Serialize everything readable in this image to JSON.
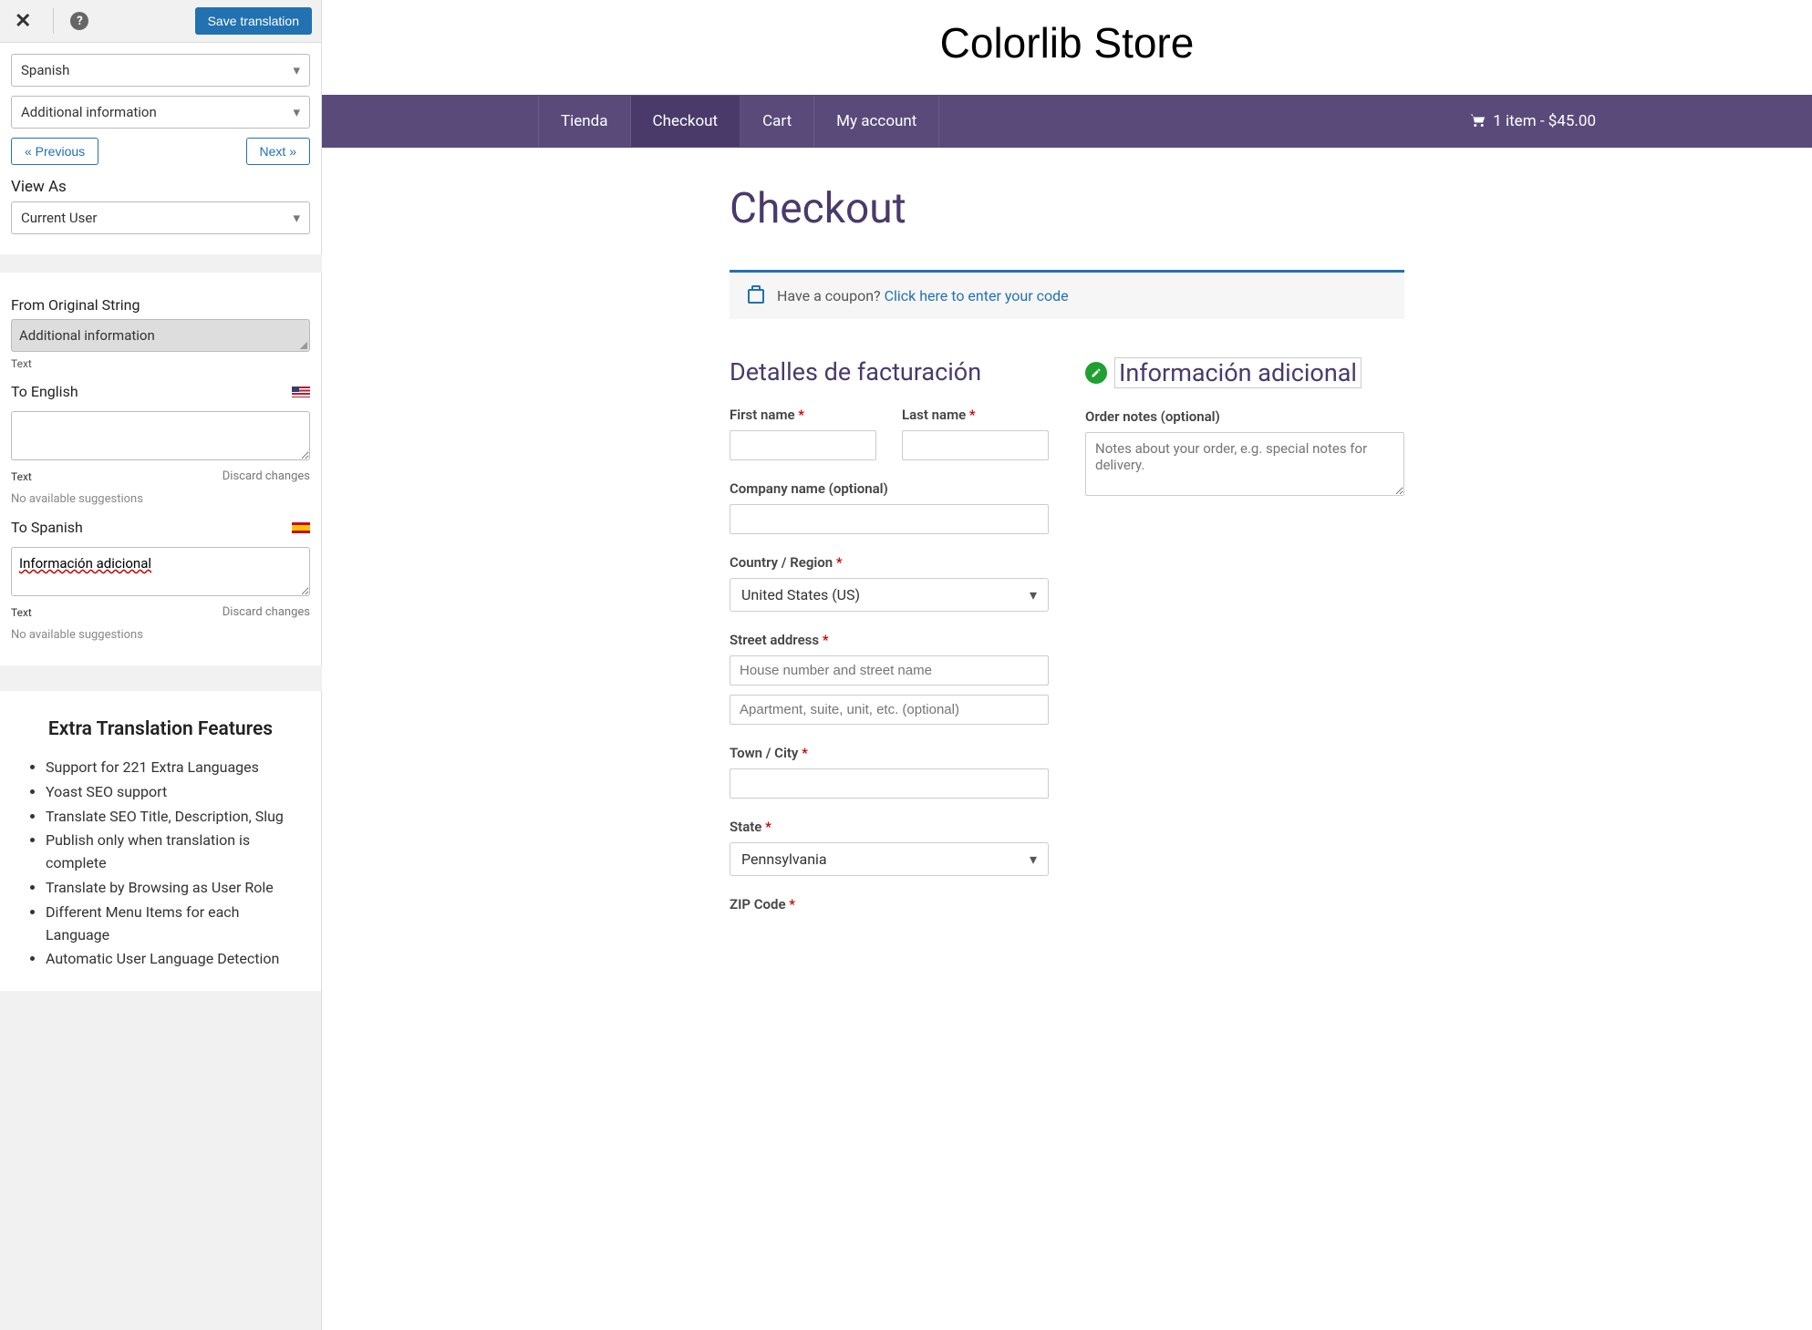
{
  "sidebar": {
    "save_label": "Save translation",
    "language_select": "Spanish",
    "string_select": "Additional information",
    "prev_label": "« Previous",
    "next_label": "Next »",
    "view_as_label": "View As",
    "view_as_value": "Current User",
    "from_label": "From Original String",
    "from_value": "Additional information",
    "text_label": "Text",
    "to_english_label": "To English",
    "to_english_value": "",
    "discard_label": "Discard changes",
    "no_suggestions": "No available suggestions",
    "to_spanish_label": "To Spanish",
    "to_spanish_value": "Información adicional"
  },
  "features": {
    "title": "Extra Translation Features",
    "items": [
      "Support for 221 Extra Languages",
      "Yoast SEO support",
      "Translate SEO Title, Description, Slug",
      "Publish only when translation is complete",
      "Translate by Browsing as User Role",
      "Different Menu Items for each Language",
      "Automatic User Language Detection"
    ]
  },
  "store": {
    "title": "Colorlib Store",
    "nav": {
      "items": [
        "Tienda",
        "Checkout",
        "Cart",
        "My account"
      ],
      "cart_summary": "1 item - $45.00"
    },
    "page_title": "Checkout",
    "coupon": {
      "prompt": "Have a coupon? ",
      "link": "Click here to enter your code"
    },
    "billing": {
      "heading": "Detalles de facturación",
      "first_name": "First name",
      "last_name": "Last name",
      "company": "Company name (optional)",
      "country": "Country / Region",
      "country_value": "United States (US)",
      "street": "Street address",
      "street_placeholder1": "House number and street name",
      "street_placeholder2": "Apartment, suite, unit, etc. (optional)",
      "town": "Town / City",
      "state": "State",
      "state_value": "Pennsylvania",
      "zip": "ZIP Code"
    },
    "additional": {
      "heading": "Información adicional",
      "notes_label": "Order notes (optional)",
      "notes_placeholder": "Notes about your order, e.g. special notes for delivery."
    }
  }
}
